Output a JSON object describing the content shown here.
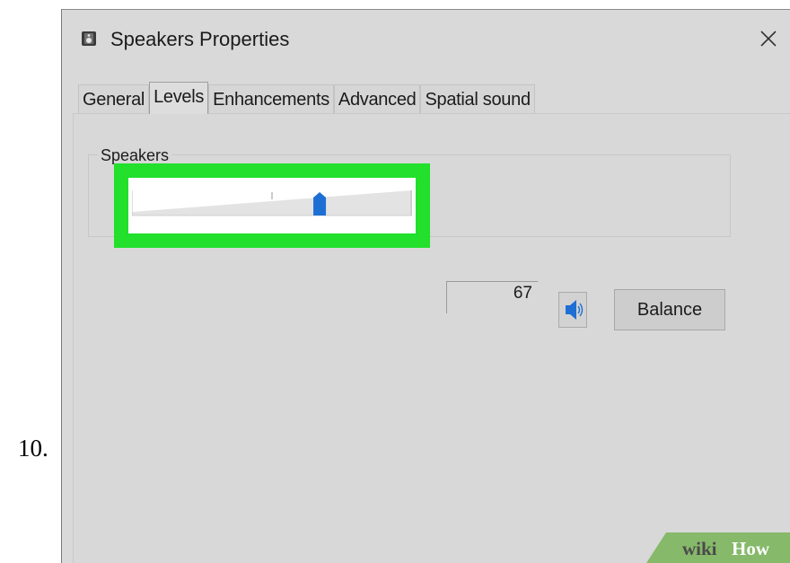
{
  "step": {
    "number": "10."
  },
  "dialog": {
    "title": "Speakers Properties",
    "icon": "speaker-icon",
    "close_icon": "close-icon"
  },
  "tabs": [
    {
      "label": "General",
      "active": false
    },
    {
      "label": "Levels",
      "active": true
    },
    {
      "label": "Enhancements",
      "active": false
    },
    {
      "label": "Advanced",
      "active": false
    },
    {
      "label": "Spatial sound",
      "active": false
    }
  ],
  "levels": {
    "group_label": "Speakers",
    "volume_value": "67",
    "volume_slider": {
      "value": 0.67,
      "min": 0,
      "max": 100
    },
    "mute_icon": "speaker-volume-icon",
    "balance_label": "Balance",
    "highlight_color": "#22e02c",
    "thumb_color": "#1e6fd4"
  },
  "watermark": {
    "brand_part1": "wiki",
    "brand_part2": "How"
  }
}
